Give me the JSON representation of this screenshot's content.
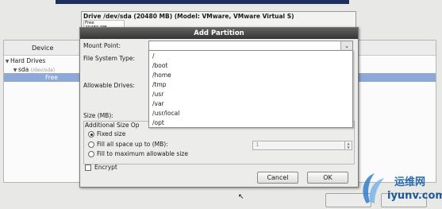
{
  "drive": {
    "title": "Drive /dev/sda (20480 MB) (Model: VMware, VMware Virtual S)",
    "segment_line1": "Free",
    "segment_line2": "20480 MB"
  },
  "device_list": {
    "column_header": "Device",
    "rows": [
      {
        "label": "Hard Drives"
      },
      {
        "label": "sda",
        "sub": "(/dev/sda)"
      },
      {
        "label": "Free"
      }
    ]
  },
  "dialog": {
    "title": "Add Partition",
    "mount_point_label": "Mount Point:",
    "mount_point_value": "",
    "mount_point_options": [
      "/",
      "/boot",
      "/home",
      "/tmp",
      "/usr",
      "/var",
      "/usr/local",
      "/opt"
    ],
    "fs_type_label": "File System Type:",
    "allowable_drives_label": "Allowable Drives:",
    "size_label": "Size (MB):",
    "additional_size_label": "Additional Size Op",
    "options": {
      "fixed_size": "Fixed size",
      "fill_up_to": "Fill all space up to (MB):",
      "fill_max": "Fill to maximum allowable size",
      "fill_up_to_value": "1",
      "selected": "fixed_size"
    },
    "encrypt_label": "Encrypt",
    "encrypt_checked": false,
    "cancel_label": "Cancel",
    "ok_label": "OK"
  },
  "watermark": {
    "chinese": "运维网",
    "url": "iyunv.com"
  },
  "colors": {
    "selection": "#8fa9d6",
    "title_bar": "#4a4a4a",
    "navy_strip": "#1f2f5e",
    "watermark_blue": "#2a6aa8"
  }
}
